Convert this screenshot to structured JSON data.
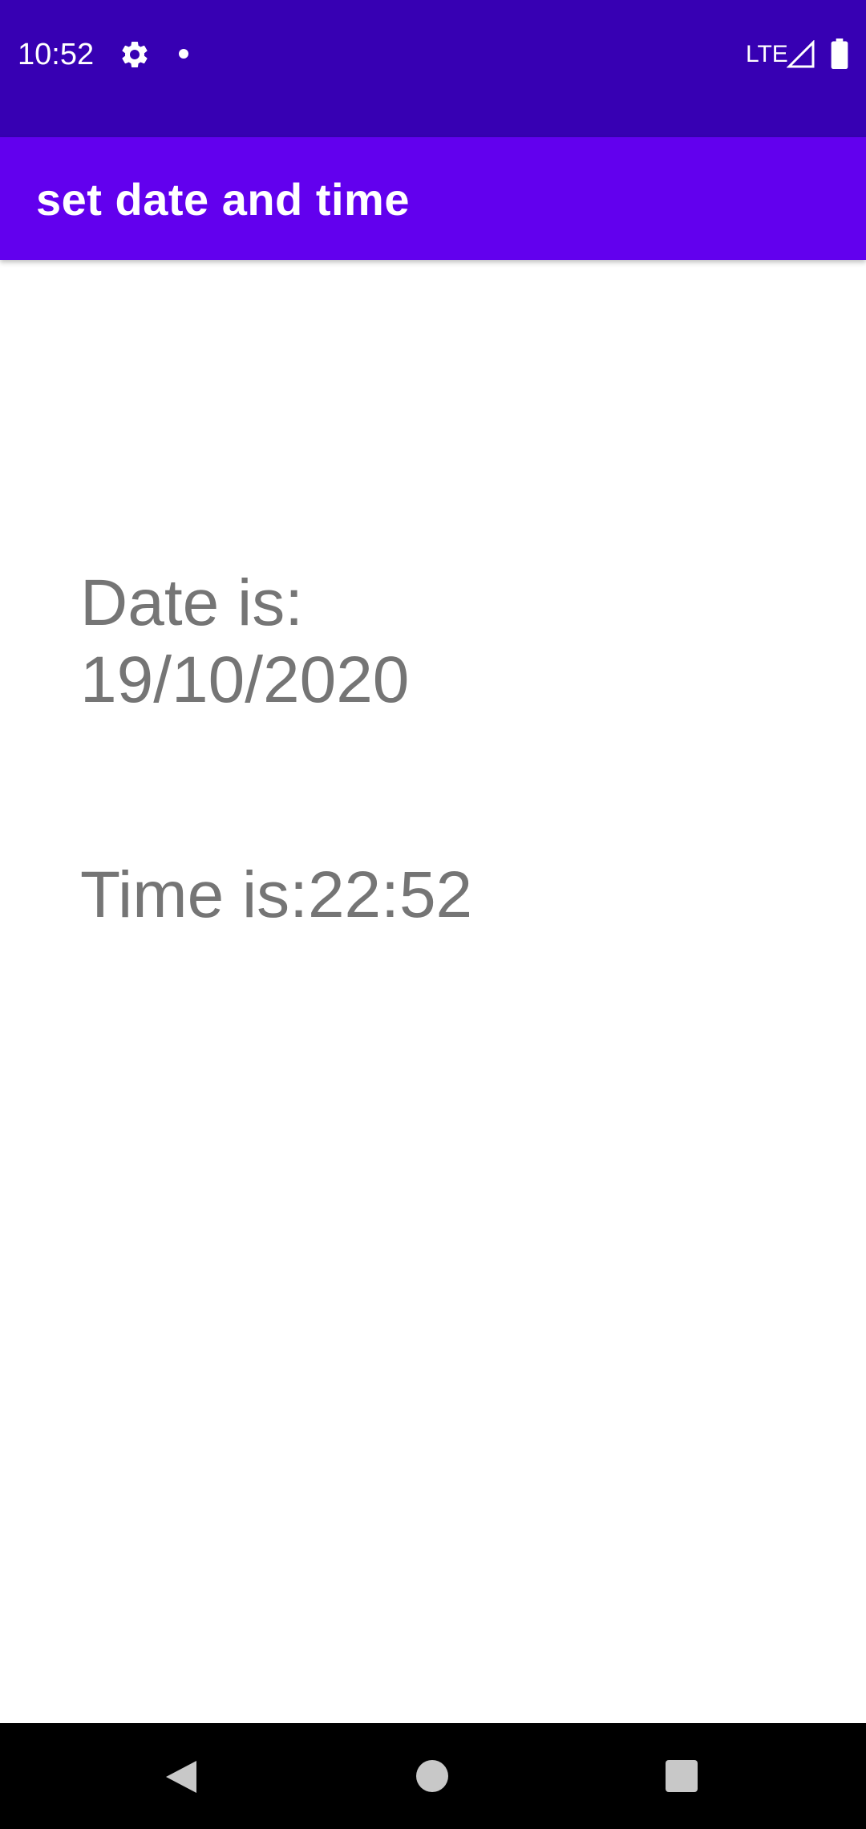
{
  "status_bar": {
    "time": "10:52",
    "network": "LTE",
    "icons": [
      "gear-icon",
      "notification-dot-icon",
      "signal-icon",
      "battery-icon"
    ],
    "background_color": "#3700b3"
  },
  "app_bar": {
    "title": "set date and time",
    "background_color": "#6200ee"
  },
  "main": {
    "date_text": "Date is: 19/10/2020",
    "time_text": "Time is:22:52",
    "text_color": "#757575"
  },
  "nav_bar": {
    "icons": [
      "back-icon",
      "home-icon",
      "recents-icon"
    ]
  }
}
